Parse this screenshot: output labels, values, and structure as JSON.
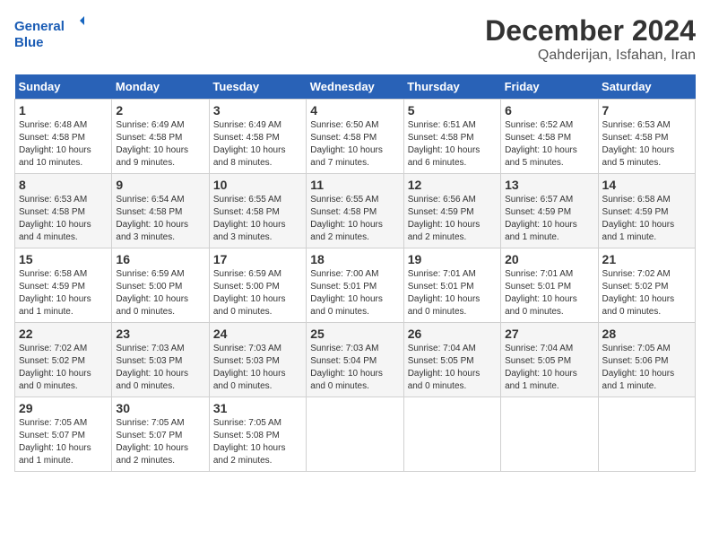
{
  "header": {
    "logo_line1": "General",
    "logo_line2": "Blue",
    "month_year": "December 2024",
    "location": "Qahderijan, Isfahan, Iran"
  },
  "weekdays": [
    "Sunday",
    "Monday",
    "Tuesday",
    "Wednesday",
    "Thursday",
    "Friday",
    "Saturday"
  ],
  "weeks": [
    [
      {
        "day": "1",
        "info": "Sunrise: 6:48 AM\nSunset: 4:58 PM\nDaylight: 10 hours and 10 minutes."
      },
      {
        "day": "2",
        "info": "Sunrise: 6:49 AM\nSunset: 4:58 PM\nDaylight: 10 hours and 9 minutes."
      },
      {
        "day": "3",
        "info": "Sunrise: 6:49 AM\nSunset: 4:58 PM\nDaylight: 10 hours and 8 minutes."
      },
      {
        "day": "4",
        "info": "Sunrise: 6:50 AM\nSunset: 4:58 PM\nDaylight: 10 hours and 7 minutes."
      },
      {
        "day": "5",
        "info": "Sunrise: 6:51 AM\nSunset: 4:58 PM\nDaylight: 10 hours and 6 minutes."
      },
      {
        "day": "6",
        "info": "Sunrise: 6:52 AM\nSunset: 4:58 PM\nDaylight: 10 hours and 5 minutes."
      },
      {
        "day": "7",
        "info": "Sunrise: 6:53 AM\nSunset: 4:58 PM\nDaylight: 10 hours and 5 minutes."
      }
    ],
    [
      {
        "day": "8",
        "info": "Sunrise: 6:53 AM\nSunset: 4:58 PM\nDaylight: 10 hours and 4 minutes."
      },
      {
        "day": "9",
        "info": "Sunrise: 6:54 AM\nSunset: 4:58 PM\nDaylight: 10 hours and 3 minutes."
      },
      {
        "day": "10",
        "info": "Sunrise: 6:55 AM\nSunset: 4:58 PM\nDaylight: 10 hours and 3 minutes."
      },
      {
        "day": "11",
        "info": "Sunrise: 6:55 AM\nSunset: 4:58 PM\nDaylight: 10 hours and 2 minutes."
      },
      {
        "day": "12",
        "info": "Sunrise: 6:56 AM\nSunset: 4:59 PM\nDaylight: 10 hours and 2 minutes."
      },
      {
        "day": "13",
        "info": "Sunrise: 6:57 AM\nSunset: 4:59 PM\nDaylight: 10 hours and 1 minute."
      },
      {
        "day": "14",
        "info": "Sunrise: 6:58 AM\nSunset: 4:59 PM\nDaylight: 10 hours and 1 minute."
      }
    ],
    [
      {
        "day": "15",
        "info": "Sunrise: 6:58 AM\nSunset: 4:59 PM\nDaylight: 10 hours and 1 minute."
      },
      {
        "day": "16",
        "info": "Sunrise: 6:59 AM\nSunset: 5:00 PM\nDaylight: 10 hours and 0 minutes."
      },
      {
        "day": "17",
        "info": "Sunrise: 6:59 AM\nSunset: 5:00 PM\nDaylight: 10 hours and 0 minutes."
      },
      {
        "day": "18",
        "info": "Sunrise: 7:00 AM\nSunset: 5:01 PM\nDaylight: 10 hours and 0 minutes."
      },
      {
        "day": "19",
        "info": "Sunrise: 7:01 AM\nSunset: 5:01 PM\nDaylight: 10 hours and 0 minutes."
      },
      {
        "day": "20",
        "info": "Sunrise: 7:01 AM\nSunset: 5:01 PM\nDaylight: 10 hours and 0 minutes."
      },
      {
        "day": "21",
        "info": "Sunrise: 7:02 AM\nSunset: 5:02 PM\nDaylight: 10 hours and 0 minutes."
      }
    ],
    [
      {
        "day": "22",
        "info": "Sunrise: 7:02 AM\nSunset: 5:02 PM\nDaylight: 10 hours and 0 minutes."
      },
      {
        "day": "23",
        "info": "Sunrise: 7:03 AM\nSunset: 5:03 PM\nDaylight: 10 hours and 0 minutes."
      },
      {
        "day": "24",
        "info": "Sunrise: 7:03 AM\nSunset: 5:03 PM\nDaylight: 10 hours and 0 minutes."
      },
      {
        "day": "25",
        "info": "Sunrise: 7:03 AM\nSunset: 5:04 PM\nDaylight: 10 hours and 0 minutes."
      },
      {
        "day": "26",
        "info": "Sunrise: 7:04 AM\nSunset: 5:05 PM\nDaylight: 10 hours and 0 minutes."
      },
      {
        "day": "27",
        "info": "Sunrise: 7:04 AM\nSunset: 5:05 PM\nDaylight: 10 hours and 1 minute."
      },
      {
        "day": "28",
        "info": "Sunrise: 7:05 AM\nSunset: 5:06 PM\nDaylight: 10 hours and 1 minute."
      }
    ],
    [
      {
        "day": "29",
        "info": "Sunrise: 7:05 AM\nSunset: 5:07 PM\nDaylight: 10 hours and 1 minute."
      },
      {
        "day": "30",
        "info": "Sunrise: 7:05 AM\nSunset: 5:07 PM\nDaylight: 10 hours and 2 minutes."
      },
      {
        "day": "31",
        "info": "Sunrise: 7:05 AM\nSunset: 5:08 PM\nDaylight: 10 hours and 2 minutes."
      },
      null,
      null,
      null,
      null
    ]
  ]
}
